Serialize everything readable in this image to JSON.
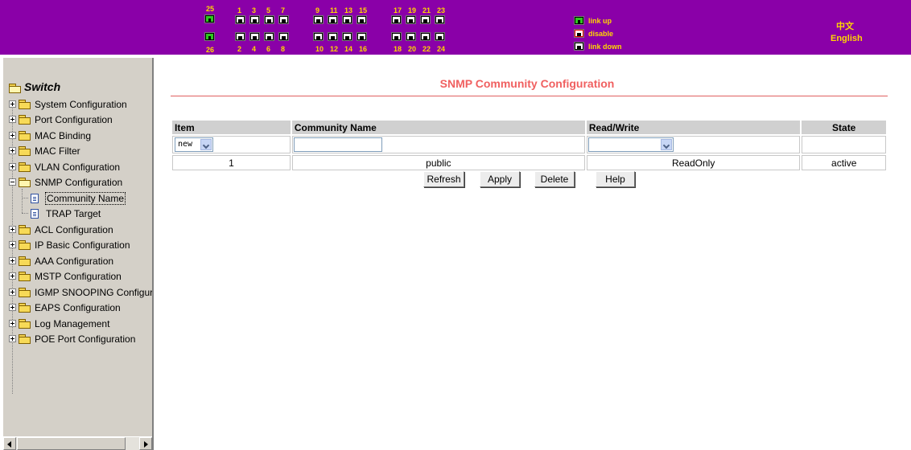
{
  "ports": {
    "top_numbers": [
      "1",
      "3",
      "5",
      "7",
      "9",
      "11",
      "13",
      "15",
      "17",
      "19",
      "21",
      "23"
    ],
    "bottom_numbers": [
      "2",
      "4",
      "6",
      "8",
      "10",
      "12",
      "14",
      "16",
      "18",
      "20",
      "22",
      "24"
    ],
    "uplink_top": "25",
    "uplink_bottom": "26"
  },
  "legend": {
    "link_up": "link up",
    "disable": "disable",
    "link_down": "link down"
  },
  "language": {
    "chinese": "中文",
    "english": "English"
  },
  "sidebar": {
    "root": "Switch",
    "items": [
      "System Configuration",
      "Port Configuration",
      "MAC Binding",
      "MAC Filter",
      "VLAN Configuration",
      "SNMP Configuration",
      "ACL Configuration",
      "IP Basic Configuration",
      "AAA Configuration",
      "MSTP Configuration",
      "IGMP SNOOPING Configura",
      "EAPS Configuration",
      "Log Management",
      "POE Port Configuration"
    ],
    "snmp_children": [
      "Community Name",
      "TRAP Target"
    ],
    "selected": "Community Name"
  },
  "page": {
    "title": "SNMP Community Configuration",
    "columns": [
      "Item",
      "Community Name",
      "Read/Write",
      "State"
    ],
    "new_row": {
      "item": "new",
      "community_name": "",
      "read_write": ""
    },
    "rows": [
      {
        "item": "1",
        "community_name": "public",
        "read_write": "ReadOnly",
        "state": "active"
      }
    ],
    "buttons": {
      "refresh": "Refresh",
      "apply": "Apply",
      "delete": "Delete",
      "help": "Help"
    }
  },
  "colors": {
    "banner": "#8a00a8",
    "banner_text": "#ffd700",
    "title": "#f06060",
    "port_green": "#2ec81e",
    "port_red": "#e00000"
  }
}
